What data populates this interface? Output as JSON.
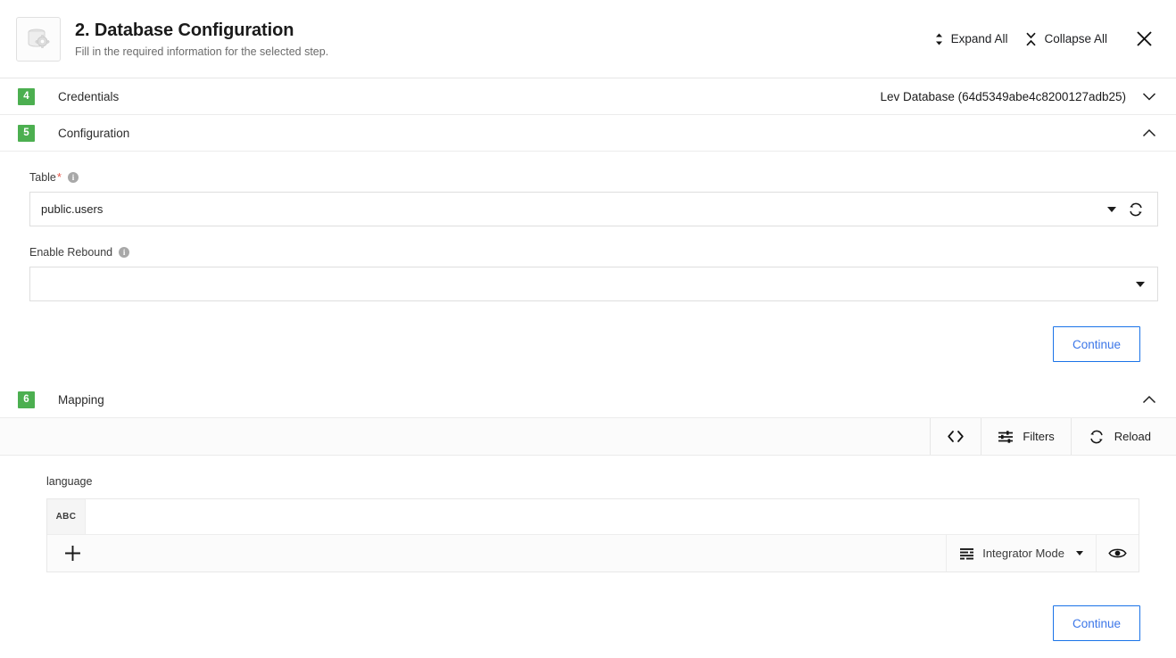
{
  "header": {
    "icon": "database-gear-icon",
    "title": "2. Database Configuration",
    "subtitle": "Fill in the required information for the selected step.",
    "expand_all_label": "Expand All",
    "collapse_all_label": "Collapse All",
    "expand_icon": "expand-chevrons-icon",
    "collapse_icon": "collapse-chevrons-icon",
    "close_icon": "close-icon"
  },
  "sections": {
    "credentials": {
      "number": "4",
      "label": "Credentials",
      "value": "Lev Database (64d5349abe4c8200127adb25)",
      "chevron": "chevron-down-icon",
      "expanded": false
    },
    "configuration": {
      "number": "5",
      "label": "Configuration",
      "chevron": "chevron-up-icon",
      "expanded": true,
      "fields": {
        "table": {
          "label": "Table",
          "required_marker": "*",
          "info_icon": "info-icon",
          "value": "public.users",
          "refresh_icon": "refresh-icon",
          "caret_icon": "caret-down-icon"
        },
        "enable_rebound": {
          "label": "Enable Rebound",
          "info_icon": "info-icon",
          "value": "",
          "caret_icon": "caret-down-icon"
        }
      },
      "continue_label": "Continue"
    },
    "mapping": {
      "number": "6",
      "label": "Mapping",
      "chevron": "chevron-up-icon",
      "expanded": true,
      "toolbar": {
        "code_icon": "code-brackets-icon",
        "filters_icon": "filters-icon",
        "filters_label": "Filters",
        "reload_icon": "reload-icon",
        "reload_label": "Reload"
      },
      "table": {
        "column_title": "language",
        "header_cell": "ABC",
        "add_icon": "plus-icon",
        "mode_icon": "list-lines-icon",
        "mode_label": "Integrator Mode",
        "mode_caret": "caret-down-icon",
        "preview_icon": "eye-icon"
      },
      "continue_label": "Continue"
    }
  },
  "colors": {
    "step_badge_green": "#4caf50",
    "primary_blue": "#3b76e8",
    "required_red": "#e8574a",
    "border_gray": "#e6e6e6"
  }
}
